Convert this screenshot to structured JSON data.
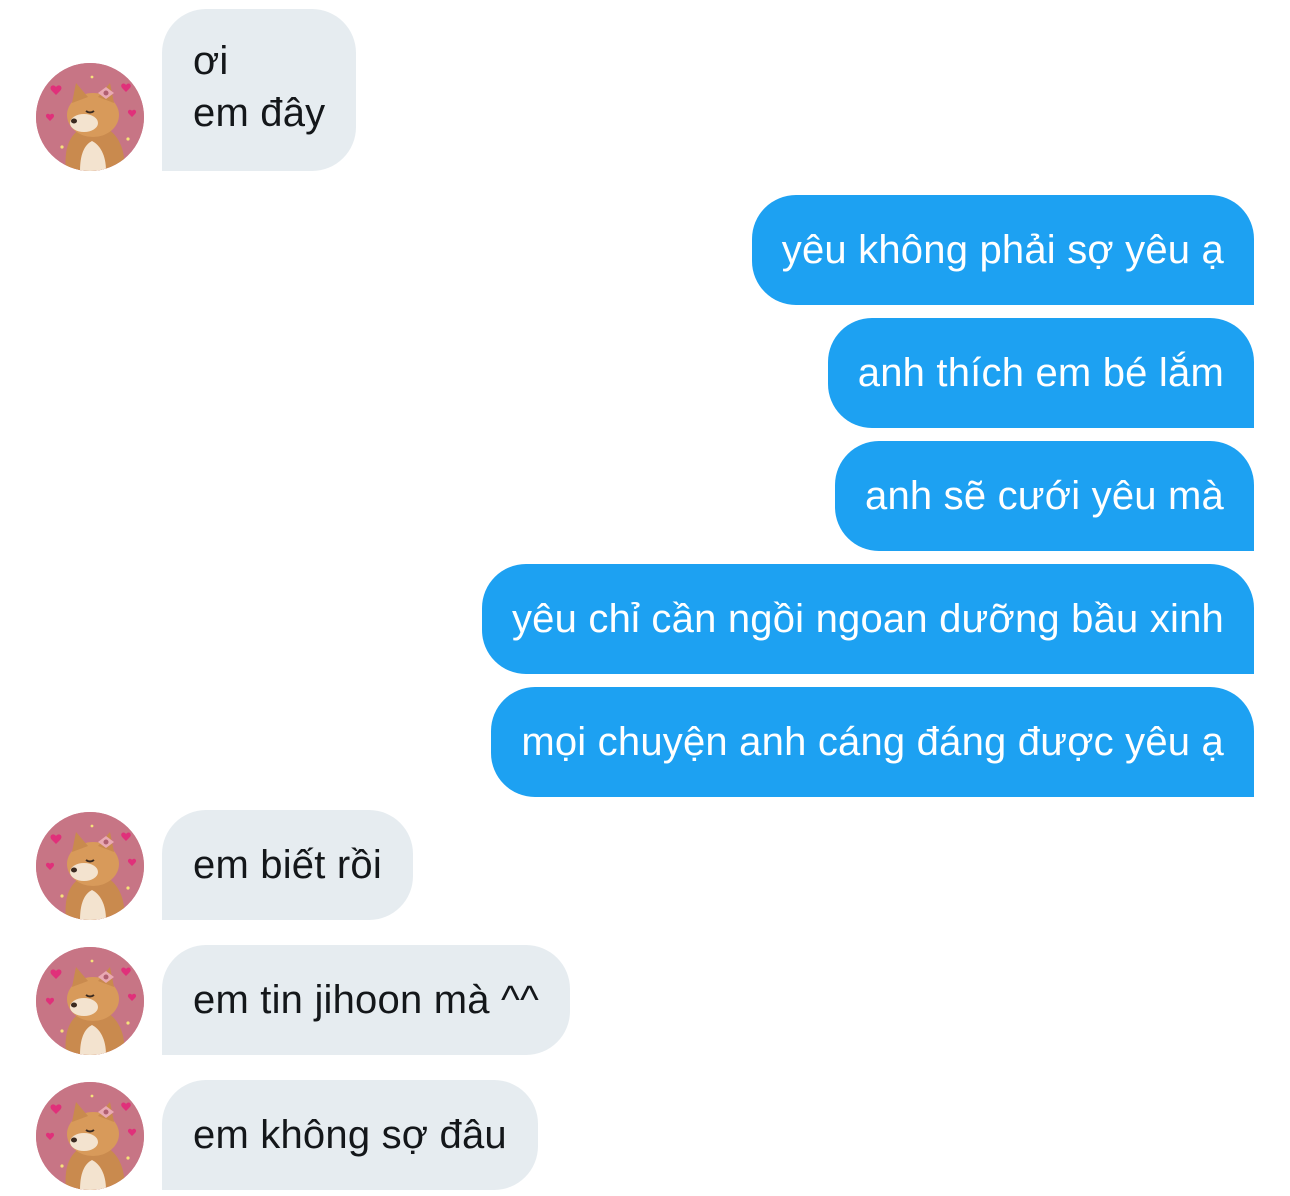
{
  "messages": [
    {
      "side": "incoming",
      "lines": [
        "ơi",
        "em đây"
      ]
    },
    {
      "side": "outgoing",
      "text": "yêu không phải sợ yêu ạ"
    },
    {
      "side": "outgoing",
      "text": "anh thích em bé lắm"
    },
    {
      "side": "outgoing",
      "text": "anh sẽ cưới yêu mà"
    },
    {
      "side": "outgoing",
      "text": "yêu chỉ cần ngồi ngoan dưỡng bầu xinh"
    },
    {
      "side": "outgoing",
      "text": "mọi chuyện anh cáng đáng được yêu ạ"
    },
    {
      "side": "incoming",
      "text": "em biết rồi"
    },
    {
      "side": "incoming",
      "text": "em tin jihoon mà ^^"
    },
    {
      "side": "incoming",
      "text": "em không sợ đâu"
    }
  ],
  "avatar": {
    "icon": "shiba-dog-with-bow-and-hearts-avatar",
    "background": "#c77585"
  },
  "colors": {
    "incoming_bubble": "#e6ecf0",
    "incoming_text": "#14171a",
    "outgoing_bubble": "#1da1f2",
    "outgoing_text": "#ffffff",
    "page_background": "#ffffff"
  }
}
